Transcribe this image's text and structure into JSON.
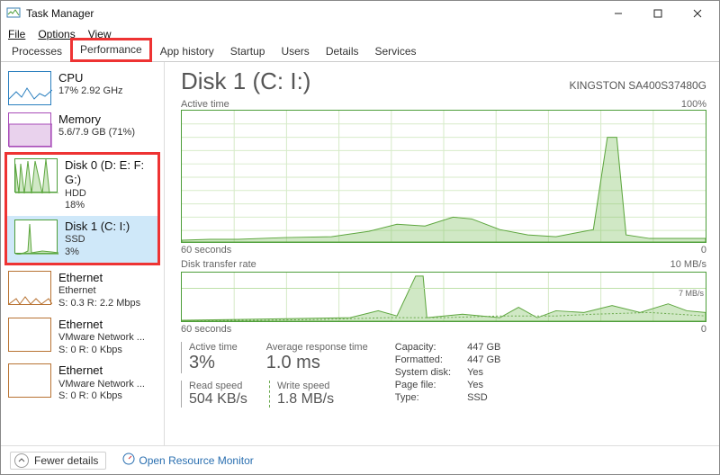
{
  "window": {
    "title": "Task Manager"
  },
  "menu": {
    "file": "File",
    "options": "Options",
    "view": "View"
  },
  "tabs": {
    "processes": "Processes",
    "performance": "Performance",
    "app_history": "App history",
    "startup": "Startup",
    "users": "Users",
    "details": "Details",
    "services": "Services"
  },
  "sidebar": {
    "cpu": {
      "title": "CPU",
      "sub": "17% 2.92 GHz"
    },
    "memory": {
      "title": "Memory",
      "sub": "5.6/7.9 GB (71%)"
    },
    "disk0": {
      "title": "Disk 0 (D: E: F: G:)",
      "sub1": "HDD",
      "sub2": "18%"
    },
    "disk1": {
      "title": "Disk 1 (C: I:)",
      "sub1": "SSD",
      "sub2": "3%"
    },
    "eth0": {
      "title": "Ethernet",
      "sub1": "Ethernet",
      "sub2": "S: 0.3 R: 2.2 Mbps"
    },
    "eth1": {
      "title": "Ethernet",
      "sub1": "VMware Network ...",
      "sub2": "S: 0 R: 0 Kbps"
    },
    "eth2": {
      "title": "Ethernet",
      "sub1": "VMware Network ...",
      "sub2": "S: 0 R: 0 Kbps"
    }
  },
  "main": {
    "title": "Disk 1 (C: I:)",
    "model": "KINGSTON SA400S37480G",
    "chart1": {
      "label": "Active time",
      "max": "100%",
      "xaxis_left": "60 seconds",
      "xaxis_right": "0"
    },
    "chart2": {
      "label": "Disk transfer rate",
      "max": "10 MB/s",
      "seven": "7 MB/s",
      "xaxis_left": "60 seconds",
      "xaxis_right": "0"
    },
    "stats": {
      "active_time": {
        "label": "Active time",
        "value": "3%"
      },
      "avg_resp": {
        "label": "Average response time",
        "value": "1.0 ms"
      },
      "read": {
        "label": "Read speed",
        "value": "504 KB/s"
      },
      "write": {
        "label": "Write speed",
        "value": "1.8 MB/s"
      }
    },
    "caps": {
      "capacity_l": "Capacity:",
      "capacity_v": "447 GB",
      "formatted_l": "Formatted:",
      "formatted_v": "447 GB",
      "sysdisk_l": "System disk:",
      "sysdisk_v": "Yes",
      "pagefile_l": "Page file:",
      "pagefile_v": "Yes",
      "type_l": "Type:",
      "type_v": "SSD"
    }
  },
  "footer": {
    "fewer": "Fewer details",
    "orm": "Open Resource Monitor"
  },
  "chart_data": [
    {
      "type": "area",
      "title": "Active time",
      "ylabel": "%",
      "ylim": [
        0,
        100
      ],
      "xlabel": "seconds ago",
      "xlim": [
        60,
        0
      ],
      "x": [
        60,
        57,
        54,
        51,
        48,
        45,
        42,
        39,
        36,
        33,
        30,
        27,
        24,
        21,
        18,
        15,
        12,
        11,
        9,
        6,
        3,
        0
      ],
      "values": [
        2,
        2,
        3,
        4,
        3,
        5,
        8,
        15,
        12,
        20,
        18,
        10,
        8,
        6,
        5,
        7,
        10,
        80,
        6,
        4,
        3,
        3
      ]
    },
    {
      "type": "line",
      "title": "Disk transfer rate",
      "ylabel": "MB/s",
      "ylim": [
        0,
        10
      ],
      "xlabel": "seconds ago",
      "xlim": [
        60,
        0
      ],
      "series": [
        {
          "name": "Read",
          "x": [
            60,
            54,
            48,
            42,
            38,
            36,
            33,
            30,
            27,
            24,
            21,
            18,
            15,
            12,
            9,
            6,
            3,
            0
          ],
          "values": [
            0.2,
            0.3,
            0.3,
            0.5,
            2.0,
            1.0,
            9.0,
            0.8,
            1.2,
            0.6,
            2.5,
            0.6,
            2.0,
            1.5,
            1.0,
            3.0,
            2.0,
            1.5
          ]
        },
        {
          "name": "Write",
          "x": [
            60,
            54,
            48,
            42,
            36,
            30,
            24,
            18,
            12,
            6,
            0
          ],
          "values": [
            0.2,
            0.2,
            0.3,
            0.4,
            0.6,
            0.5,
            0.8,
            0.6,
            1.0,
            1.2,
            0.9
          ]
        }
      ]
    }
  ]
}
